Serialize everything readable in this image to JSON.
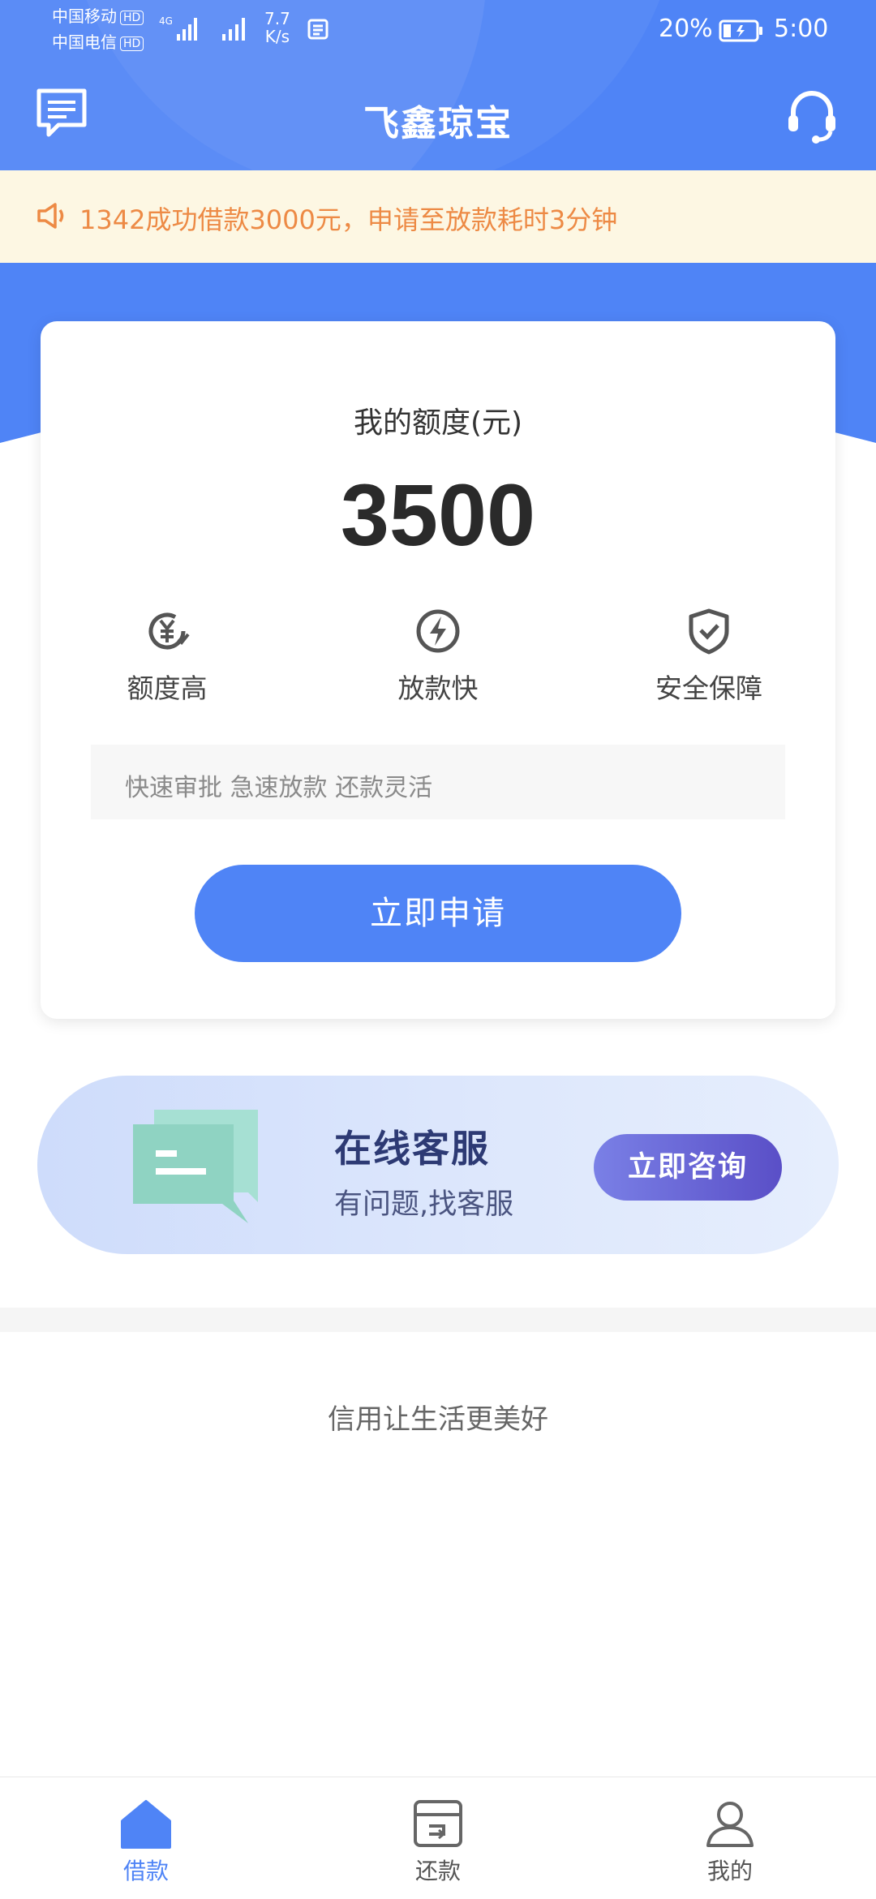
{
  "status_bar": {
    "carrier1": "中国移动",
    "carrier2": "中国电信",
    "hd_badge": "HD",
    "network_type": "4G",
    "net_speed_value": "7.7",
    "net_speed_unit": "K/s",
    "battery_percent": "20%",
    "time": "5:00"
  },
  "nav": {
    "title": "飞鑫琼宝",
    "left_icon": "message-icon",
    "right_icon": "headset-icon"
  },
  "notice": {
    "icon": "speaker-icon",
    "text": "1342成功借款3000元，申请至放款耗时3分钟"
  },
  "card": {
    "limit_label": "我的额度(元)",
    "amount": "3500",
    "features": [
      {
        "label": "额度高",
        "icon": "yuan-icon"
      },
      {
        "label": "放款快",
        "icon": "lightning-icon"
      },
      {
        "label": "安全保障",
        "icon": "shield-check-icon"
      }
    ],
    "slogan": "快速审批 急速放款 还款灵活",
    "apply_button": "立即申请"
  },
  "service_banner": {
    "title": "在线客服",
    "subtitle": "有问题,找客服",
    "button": "立即咨询",
    "icon": "chat-bubbles-icon"
  },
  "footer_slogan": "信用让生活更美好",
  "tabbar": {
    "items": [
      {
        "label": "借款",
        "icon": "home-icon",
        "active": true
      },
      {
        "label": "还款",
        "icon": "repay-icon",
        "active": false
      },
      {
        "label": "我的",
        "icon": "user-icon",
        "active": false
      }
    ]
  },
  "colors": {
    "brand_blue": "#4f84f6",
    "notice_bg": "#fdf7e3",
    "notice_text": "#ed8a45",
    "banner_button": "#5a4fc7"
  }
}
